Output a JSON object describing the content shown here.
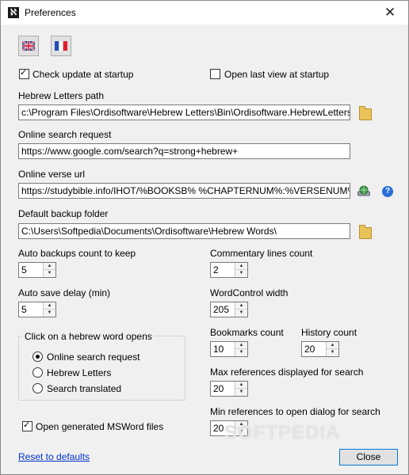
{
  "window": {
    "title": "Preferences",
    "app_icon_glyph": "ℵ"
  },
  "checkboxes": {
    "check_update": {
      "label": "Check update at startup",
      "checked": true
    },
    "open_last_view": {
      "label": "Open last view at startup",
      "checked": false
    },
    "open_msword": {
      "label": "Open generated MSWord files",
      "checked": true
    }
  },
  "fields": {
    "hebrew_letters_path": {
      "label": "Hebrew Letters path",
      "value": "c:\\Program Files\\Ordisoftware\\Hebrew Letters\\Bin\\Ordisoftware.HebrewLetters.exe"
    },
    "online_search": {
      "label": "Online search request",
      "value": "https://www.google.com/search?q=strong+hebrew+"
    },
    "online_verse": {
      "label": "Online verse url",
      "value": "https://studybible.info/IHOT/%BOOKSB% %CHAPTERNUM%:%VERSENUM%"
    },
    "backup_folder": {
      "label": "Default backup folder",
      "value": "C:\\Users\\Softpedia\\Documents\\Ordisoftware\\Hebrew Words\\"
    }
  },
  "spinners": {
    "auto_backups": {
      "label": "Auto backups count to keep",
      "value": "5"
    },
    "auto_save": {
      "label": "Auto save delay (min)",
      "value": "5"
    },
    "commentary_lines": {
      "label": "Commentary lines count",
      "value": "2"
    },
    "wordcontrol_width": {
      "label": "WordControl width",
      "value": "205"
    },
    "bookmarks": {
      "label": "Bookmarks count",
      "value": "10"
    },
    "history": {
      "label": "History count",
      "value": "20"
    },
    "max_refs": {
      "label": "Max references displayed for search",
      "value": "20"
    },
    "min_refs": {
      "label": "Min references to open dialog for search",
      "value": "20"
    }
  },
  "group": {
    "title": "Click on a hebrew word opens",
    "options": [
      {
        "label": "Online search request",
        "selected": true
      },
      {
        "label": "Hebrew Letters",
        "selected": false
      },
      {
        "label": "Search translated",
        "selected": false
      }
    ]
  },
  "footer": {
    "reset_link": "Reset to defaults",
    "close_button": "Close"
  },
  "watermark": "SOFTPEDIA",
  "icons": {
    "close": "close-icon",
    "folder": "folder-icon",
    "globe": "globe-icon",
    "help": "help-icon",
    "flag_uk": "uk-flag-icon",
    "flag_fr": "france-flag-icon"
  },
  "colors": {
    "link": "#0033cc",
    "accent": "#0078d7",
    "help": "#2a6fd6",
    "folder": "#e9c35a"
  }
}
